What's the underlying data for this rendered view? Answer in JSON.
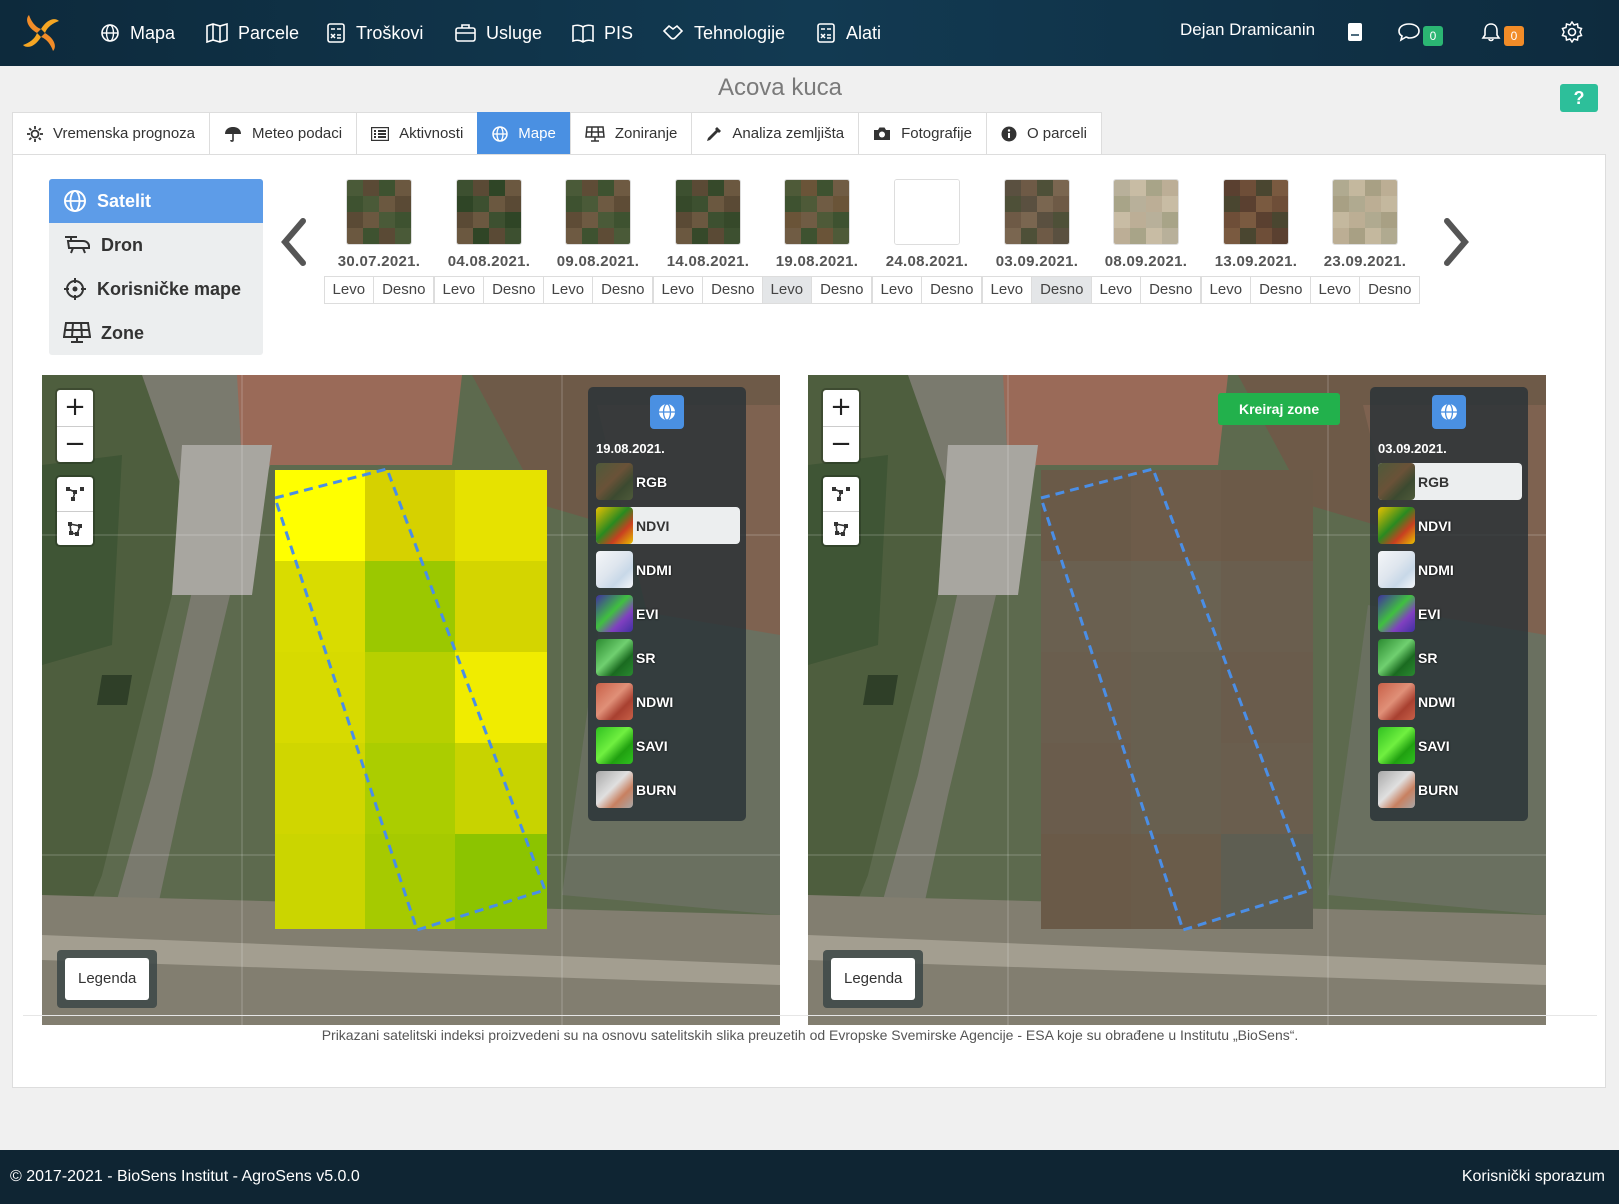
{
  "nav": {
    "items": [
      {
        "label": "Mapa",
        "icon": "globe-icon"
      },
      {
        "label": "Parcele",
        "icon": "map-icon"
      },
      {
        "label": "Troškovi",
        "icon": "calculator-icon"
      },
      {
        "label": "Usluge",
        "icon": "briefcase-icon"
      },
      {
        "label": "PIS",
        "icon": "book-icon"
      },
      {
        "label": "Tehnologije",
        "icon": "handshake-icon"
      },
      {
        "label": "Alati",
        "icon": "calculator-icon"
      }
    ],
    "user": "Dejan Dramicanin",
    "messages_count": "0",
    "notifications_count": "0"
  },
  "page": {
    "title": "Acova kuca",
    "help": "?"
  },
  "tabs": [
    {
      "label": "Vremenska prognoza",
      "icon": "sun-icon"
    },
    {
      "label": "Meteo podaci",
      "icon": "umbrella-icon"
    },
    {
      "label": "Aktivnosti",
      "icon": "list-icon"
    },
    {
      "label": "Mape",
      "icon": "globe-icon",
      "active": true
    },
    {
      "label": "Zoniranje",
      "icon": "solar-panel-icon"
    },
    {
      "label": "Analiza zemljišta",
      "icon": "pipette-icon"
    },
    {
      "label": "Fotografije",
      "icon": "camera-icon"
    },
    {
      "label": "O parceli",
      "icon": "info-icon"
    }
  ],
  "side_menu": [
    {
      "label": "Satelit",
      "icon": "globe-icon",
      "active": true
    },
    {
      "label": "Dron",
      "icon": "drone-icon"
    },
    {
      "label": "Korisničke mape",
      "icon": "crosshair-icon"
    },
    {
      "label": "Zone",
      "icon": "solar-panel-icon"
    }
  ],
  "dates": [
    {
      "date": "30.07.2021.",
      "left": "Levo",
      "right": "Desno",
      "palette": [
        "#4a5a38",
        "#5a4a35",
        "#3e5230",
        "#6b5840"
      ]
    },
    {
      "date": "04.08.2021.",
      "left": "Levo",
      "right": "Desno",
      "palette": [
        "#3d5030",
        "#5a4a35",
        "#2f4526",
        "#6b5840"
      ]
    },
    {
      "date": "09.08.2021.",
      "left": "Levo",
      "right": "Desno",
      "palette": [
        "#4a5a38",
        "#5e4c36",
        "#3e5230",
        "#6e5a42"
      ]
    },
    {
      "date": "14.08.2021.",
      "left": "Levo",
      "right": "Desno",
      "palette": [
        "#3d5030",
        "#5a4a35",
        "#36492a",
        "#6b5840"
      ]
    },
    {
      "date": "19.08.2021.",
      "left": "Levo",
      "right": "Desno",
      "palette": [
        "#4e5a38",
        "#6a5438",
        "#3e5230",
        "#705c44"
      ],
      "left_on": true
    },
    {
      "date": "24.08.2021.",
      "left": "Levo",
      "right": "Desno",
      "palette": [
        "#ffffff",
        "#ffffff",
        "#ffffff",
        "#ffffff"
      ]
    },
    {
      "date": "03.09.2021.",
      "left": "Levo",
      "right": "Desno",
      "palette": [
        "#5a5040",
        "#6e5a46",
        "#4e5038",
        "#7a6650"
      ],
      "right_on": true
    },
    {
      "date": "08.09.2021.",
      "left": "Levo",
      "right": "Desno",
      "palette": [
        "#b8b09a",
        "#c8bca4",
        "#a8a488",
        "#bcae96"
      ]
    },
    {
      "date": "13.09.2021.",
      "left": "Levo",
      "right": "Desno",
      "palette": [
        "#5a4030",
        "#6e4e38",
        "#4a4630",
        "#7a5a40"
      ]
    },
    {
      "date": "23.09.2021.",
      "left": "Levo",
      "right": "Desno",
      "palette": [
        "#b0aa90",
        "#c4b89e",
        "#a8a084",
        "#bcae94"
      ]
    }
  ],
  "maps": [
    {
      "id": "left",
      "date": "19.08.2021.",
      "selected_layer": "NDVI",
      "legend": "Legenda",
      "zoom_in": "+",
      "zoom_out": "−"
    },
    {
      "id": "right",
      "date": "03.09.2021.",
      "selected_layer": "RGB",
      "legend": "Legenda",
      "zoom_in": "+",
      "zoom_out": "−",
      "create_zones": "Kreiraj zone"
    }
  ],
  "layers": [
    {
      "label": "RGB",
      "colors": [
        "#4e5a3a",
        "#6a5238",
        "#3c4a30"
      ]
    },
    {
      "label": "NDVI",
      "colors": [
        "#e8c000",
        "#2a8a20",
        "#c84020"
      ]
    },
    {
      "label": "NDMI",
      "colors": [
        "#f4f6f8",
        "#dfe6ee",
        "#c8d8e8"
      ]
    },
    {
      "label": "EVI",
      "colors": [
        "#4030a0",
        "#40c040",
        "#8040c0"
      ]
    },
    {
      "label": "SR",
      "colors": [
        "#2a8a30",
        "#70d070",
        "#1a6a20"
      ]
    },
    {
      "label": "NDWI",
      "colors": [
        "#c86048",
        "#e09078",
        "#a84030"
      ]
    },
    {
      "label": "SAVI",
      "colors": [
        "#30c020",
        "#70f040",
        "#20a010"
      ]
    },
    {
      "label": "BURN",
      "colors": [
        "#a8a8a8",
        "#e0e0e0",
        "#c88060"
      ]
    }
  ],
  "footnote": "Prikazani satelitski indeksi proizvedeni su na osnovu satelitskih slika preuzetih od Evropske Svemirske Agencije - ESA koje su obrađene u Institutu „BioSens“.",
  "footer": {
    "copyright": "© 2017-2021 - BioSens Institut - AgroSens v5.0.0",
    "agreement": "Korisnički sporazum"
  },
  "colors": {
    "nav_bg": "#0d2a3c",
    "accent": "#4a90e2",
    "green": "#22b14c",
    "footer_bg": "#0f2533"
  }
}
